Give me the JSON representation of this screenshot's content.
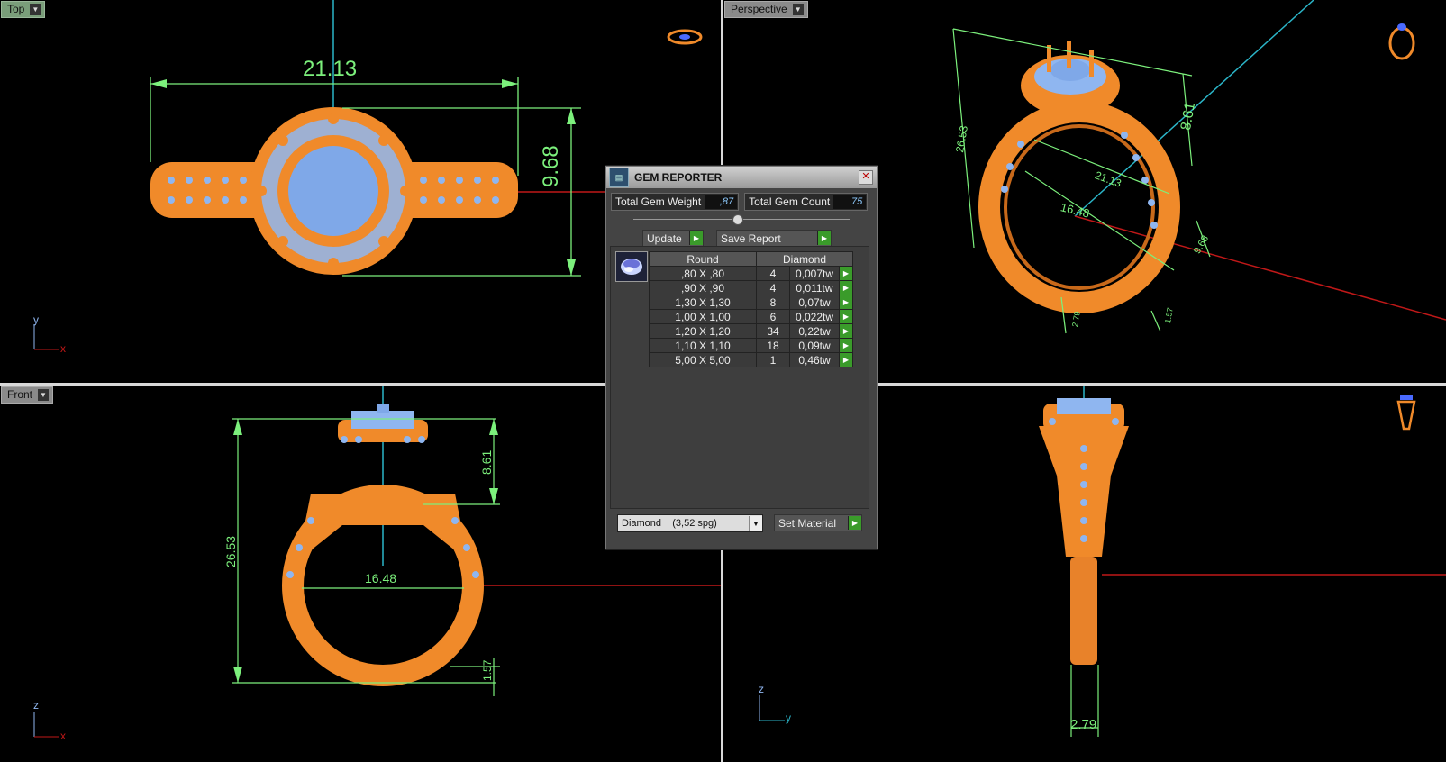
{
  "viewports": {
    "top": {
      "label": "Top",
      "dims": {
        "width": "21.13",
        "height": "9.68"
      },
      "axes": [
        "y",
        "x"
      ]
    },
    "perspective": {
      "label": "Perspective",
      "dims": {
        "d1": "26.53",
        "d2": "8.61",
        "d3": "21.13",
        "d4": "16.48",
        "d5": "9.68",
        "d6": "2.79",
        "d7": "1.57"
      }
    },
    "front": {
      "label": "Front",
      "dims": {
        "height": "26.53",
        "head": "8.61",
        "inner": "16.48",
        "shank": "1.57"
      },
      "axes": [
        "z",
        "x"
      ]
    },
    "side": {
      "dims": {
        "band": "2.79"
      },
      "axes": [
        "z",
        "y"
      ]
    }
  },
  "gem_reporter": {
    "title": "GEM REPORTER",
    "total_weight_label": "Total Gem Weight",
    "total_weight_value": ",87",
    "total_count_label": "Total Gem Count",
    "total_count_value": "75",
    "update_label": "Update",
    "save_label": "Save Report",
    "table": {
      "headers": [
        "Round",
        "Diamond"
      ],
      "rows": [
        {
          "size": ",80 X ,80",
          "count": "4",
          "weight": "0,007tw"
        },
        {
          "size": ",90 X ,90",
          "count": "4",
          "weight": "0,011tw"
        },
        {
          "size": "1,30 X 1,30",
          "count": "8",
          "weight": "0,07tw"
        },
        {
          "size": "1,00 X 1,00",
          "count": "6",
          "weight": "0,022tw"
        },
        {
          "size": "1,20 X 1,20",
          "count": "34",
          "weight": "0,22tw"
        },
        {
          "size": "1,10 X 1,10",
          "count": "18",
          "weight": "0,09tw"
        },
        {
          "size": "5,00 X 5,00",
          "count": "1",
          "weight": "0,46tw"
        }
      ]
    },
    "material_select": "Diamond    (3,52 spg)",
    "set_material_label": "Set Material"
  },
  "colors": {
    "metal": "#f08a2a",
    "gem": "#8fb6f0",
    "dimension": "#7cf07c",
    "axis_red": "#c01818",
    "axis_cyan": "#2bb5c8"
  }
}
